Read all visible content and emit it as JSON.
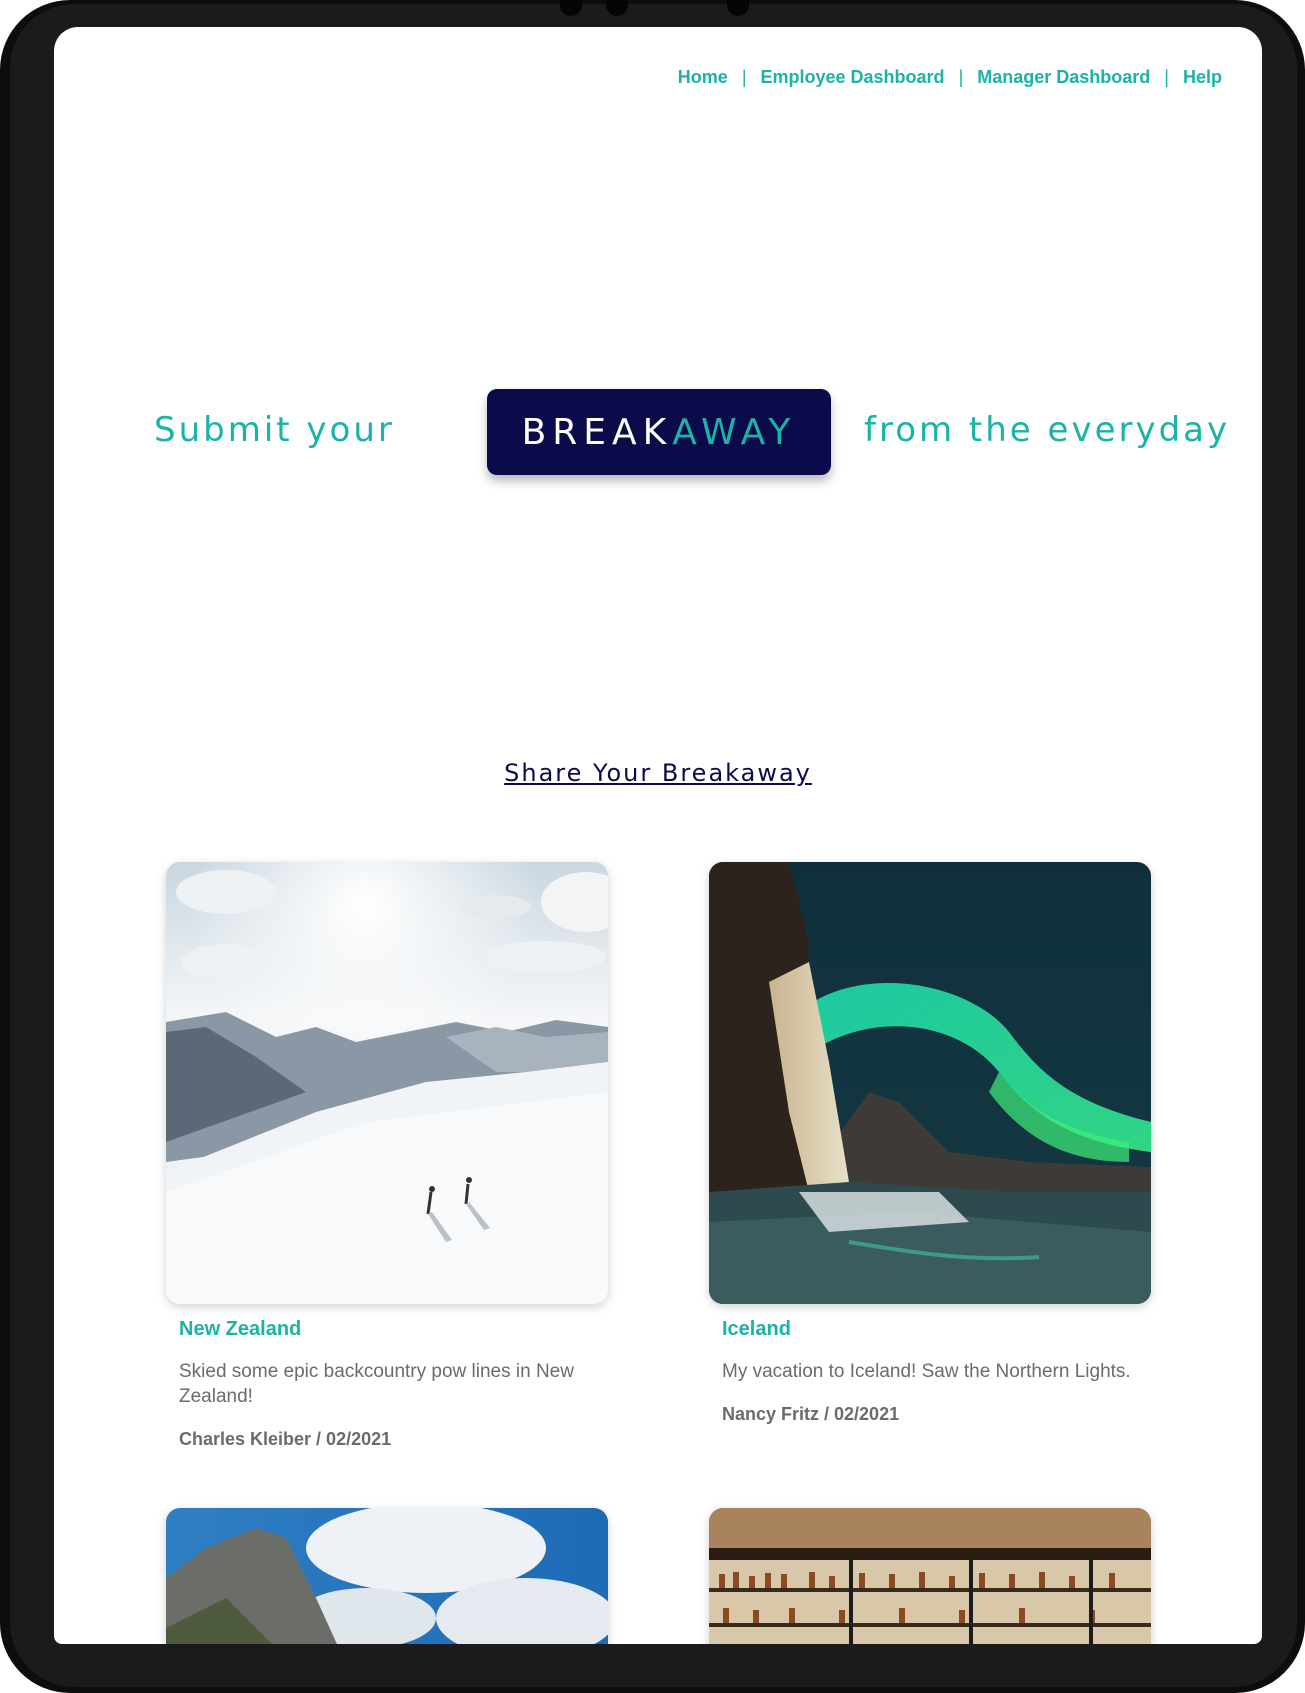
{
  "nav": {
    "items": [
      "Home",
      "Employee Dashboard",
      "Manager Dashboard",
      "Help"
    ],
    "separator": "|"
  },
  "hero": {
    "left_text": "Submit your",
    "logo_part1": "BREAK",
    "logo_part2": "AWAY",
    "right_text": "from the everyday"
  },
  "share_link": "Share Your Breakaway",
  "posts": [
    {
      "title": "New Zealand",
      "description": "Skied some epic backcountry pow lines in New Zealand!",
      "meta": "Charles Kleiber / 02/2021",
      "image": "snowy-mountain-skiers-photo"
    },
    {
      "title": "Iceland",
      "description": "My vacation to Iceland! Saw the Northern Lights.",
      "meta": "Nancy Fritz / 02/2021",
      "image": "northern-lights-ice-cliff-photo"
    },
    {
      "image": "mountain-blue-sky-photo"
    },
    {
      "image": "restaurant-bar-interior-photo"
    }
  ],
  "colors": {
    "accent": "#1ab3a6",
    "navy": "#0b0a4a",
    "body_text": "#6b6b6b"
  }
}
